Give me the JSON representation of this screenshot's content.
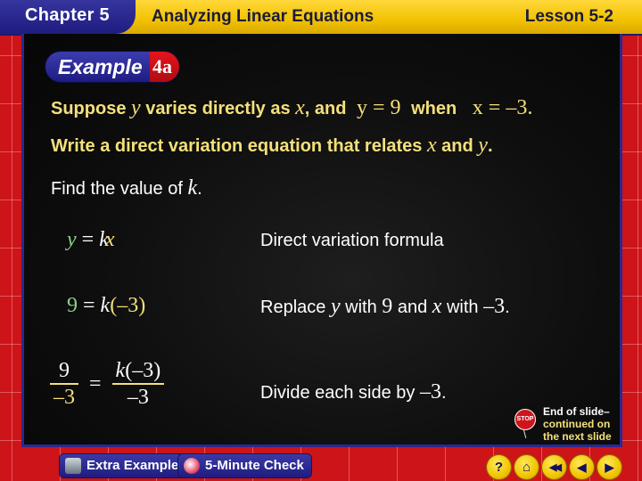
{
  "header": {
    "chapter": "Chapter 5",
    "title": "Analyzing Linear Equations",
    "lesson": "Lesson 5-2"
  },
  "badge": {
    "label": "Example",
    "number": "4a"
  },
  "problem": {
    "line1": {
      "t1": "Suppose ",
      "v1": "y",
      "t2": " varies directly as ",
      "v2": "x",
      "t3": ", and ",
      "eq1": "y = 9",
      "t4": " when ",
      "eq2": "x = –3."
    },
    "line2": {
      "t1": "Write a direct variation equation that relates ",
      "v1": "x",
      "t2": " and ",
      "v2": "y",
      "t3": "."
    },
    "line3": {
      "t1": "Find the value of ",
      "v1": "k",
      "t2": "."
    }
  },
  "steps": [
    {
      "equation": {
        "lhs": "y",
        "eq": "=",
        "k": "k",
        "rhs": "x"
      },
      "note": "Direct variation formula"
    },
    {
      "equation": {
        "lhs": "9",
        "eq": "=",
        "k": "k",
        "rhs": "(–3)"
      },
      "note": {
        "t1": "Replace ",
        "v1": "y",
        "t2": " with ",
        "n1": "9",
        "t3": " and ",
        "v2": "x",
        "t4": " with ",
        "n2": "–3",
        "t5": "."
      }
    },
    {
      "equation": {
        "num_l": "9",
        "den_l": "–3",
        "eq": "=",
        "num_r_k": "k",
        "num_r": "(–3)",
        "den_r": "–3"
      },
      "note": {
        "t1": "Divide each side by ",
        "n1": "–3",
        "t2": "."
      }
    }
  ],
  "end_of_slide": {
    "stop": "STOP",
    "line1": "End of slide–",
    "line2": "continued on",
    "line3": "the next slide"
  },
  "footer": {
    "extra_examples": "Extra Examples",
    "five_minute_check": "5-Minute Check",
    "nav": {
      "help": "?",
      "home": "⌂",
      "first": "◀◀",
      "prev": "◀",
      "next": "▶"
    }
  }
}
